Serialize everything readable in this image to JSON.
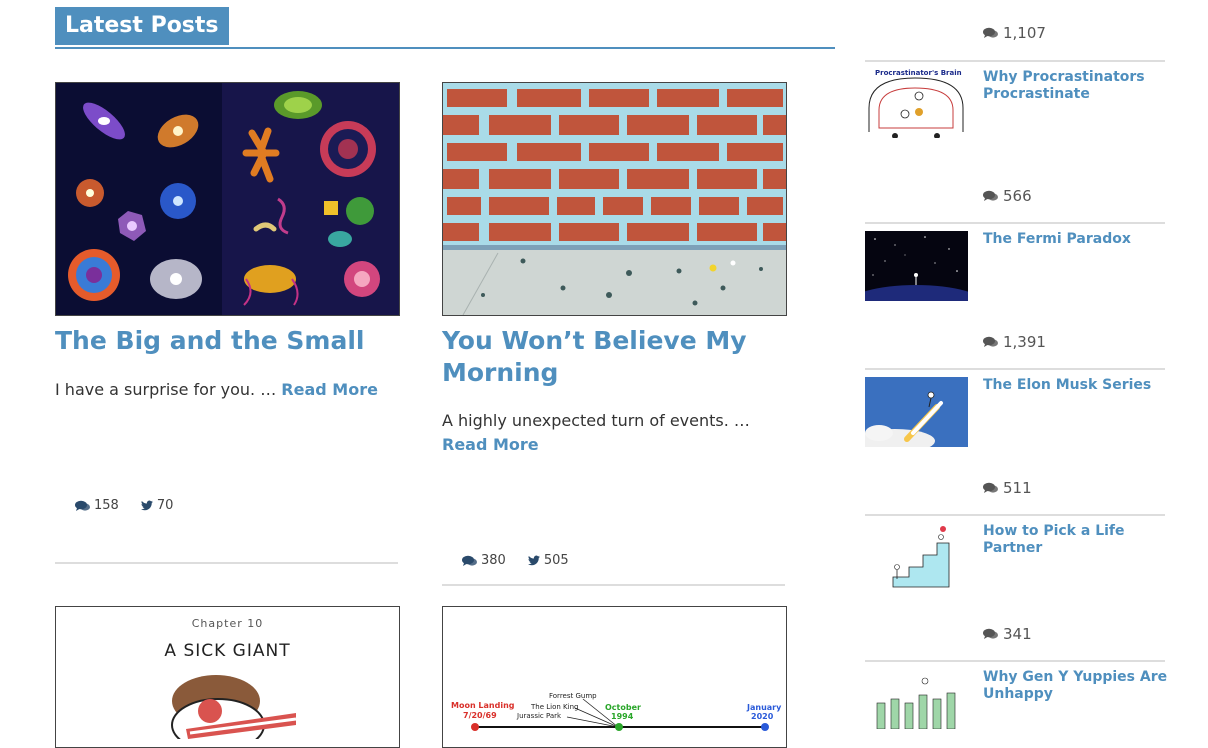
{
  "section": {
    "title": "Latest Posts"
  },
  "posts": [
    {
      "title": "The Big and the Small",
      "excerpt": "I have a surprise for you. … ",
      "read_more": "Read More",
      "comments": "158",
      "tweets": "70"
    },
    {
      "title": "You Won’t Believe My Morning",
      "excerpt": "A highly unexpected turn of events. … ",
      "read_more": "Read More",
      "comments": "380",
      "tweets": "505"
    },
    {
      "chapter": "Chapter 10",
      "heading": "A SICK GIANT"
    },
    {
      "timeline": {
        "left_label": "Moon Landing",
        "left_date": "7/20/69",
        "mid_labels": [
          "Forrest Gump",
          "The Lion King",
          "Jurassic Park"
        ],
        "mid_label": "October",
        "mid_date": "1994",
        "right_label": "January",
        "right_date": "2020"
      }
    }
  ],
  "sidebar": {
    "top_count": "1,107",
    "items": [
      {
        "title": "Why Procrastinators Procrastinate",
        "thumb_caption": "Procrastinator's Brain",
        "count": "566"
      },
      {
        "title": "The Fermi Paradox",
        "count": "1,391"
      },
      {
        "title": "The Elon Musk Series",
        "count": "511"
      },
      {
        "title": "How to Pick a Life Partner",
        "count": "341"
      },
      {
        "title": "Why Gen Y Yuppies Are Unhappy"
      }
    ]
  },
  "colors": {
    "accent": "#4f8fbe"
  }
}
